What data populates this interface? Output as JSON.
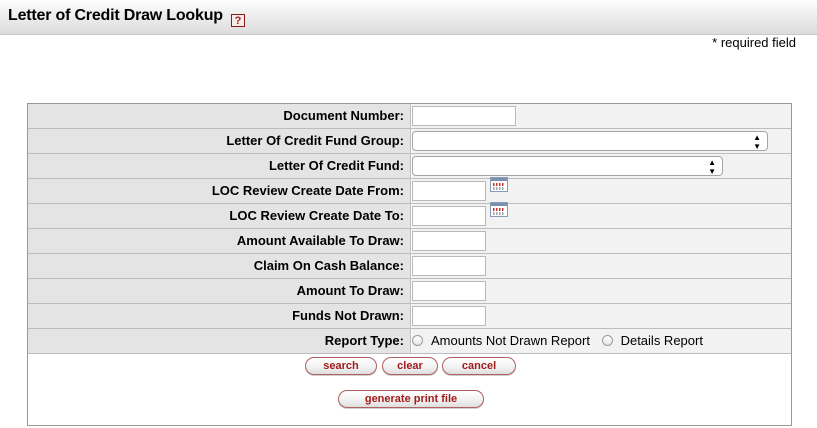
{
  "header": {
    "title": "Letter of Credit Draw Lookup",
    "help_glyph": "?"
  },
  "required_note": "* required field",
  "form": {
    "document_number": {
      "label": "Document Number:",
      "value": ""
    },
    "loc_fund_group": {
      "label": "Letter Of Credit Fund Group:",
      "selected": ""
    },
    "loc_fund": {
      "label": "Letter Of Credit Fund:",
      "selected": ""
    },
    "review_date_from": {
      "label": "LOC Review Create Date From:",
      "value": ""
    },
    "review_date_to": {
      "label": "LOC Review Create Date To:",
      "value": ""
    },
    "amount_available": {
      "label": "Amount Available To Draw:",
      "value": ""
    },
    "claim_on_cash": {
      "label": "Claim On Cash Balance:",
      "value": ""
    },
    "amount_to_draw": {
      "label": "Amount To Draw:",
      "value": ""
    },
    "funds_not_drawn": {
      "label": "Funds Not Drawn:",
      "value": ""
    },
    "report_type": {
      "label": "Report Type:",
      "options": [
        "Amounts Not Drawn Report",
        "Details Report"
      ]
    }
  },
  "buttons": {
    "search": "search",
    "clear": "clear",
    "cancel": "cancel",
    "generate": "generate print file"
  },
  "icons": {
    "help": "help-icon",
    "calendar": "calendar-icon",
    "select_arrows": "up-down-arrows-icon"
  },
  "colors": {
    "label_bg": "#e4e4e4",
    "field_bg": "#f2f2f2",
    "button_text": "#a21c1c"
  }
}
